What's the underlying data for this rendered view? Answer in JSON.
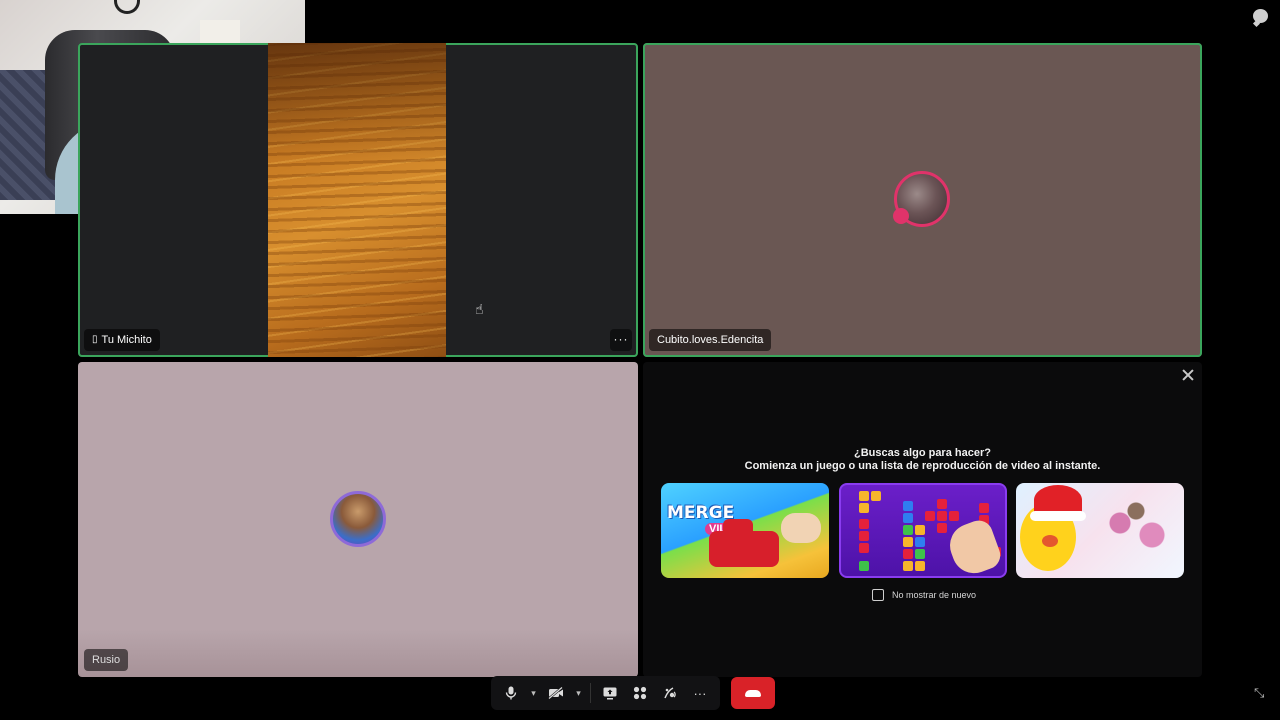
{
  "participants": [
    {
      "name": "Tu Michito",
      "device": "phone-icon"
    },
    {
      "name": "Cubito.loves.Edencita"
    },
    {
      "name": "Rusio"
    }
  ],
  "activity_panel": {
    "title": "¿Buscas algo para hacer?",
    "subtitle": "Comienza un juego o una lista de reproducción de video al instante.",
    "games": [
      {
        "name": "Merge Villes",
        "logo_text": "MERGE",
        "logo_sub": "VILLES"
      },
      {
        "name": "Block puzzle"
      },
      {
        "name": "Chick holiday"
      }
    ],
    "dont_show_label": "No mostrar de nuevo",
    "dont_show_checked": false
  },
  "toolbar": {
    "buttons": [
      "microphone-icon",
      "camera-off-icon",
      "screen-share-icon",
      "activities-icon",
      "soundboard-icon",
      "more-icon",
      "end-call-icon"
    ],
    "more_label": "···",
    "end_call_color": "#d92228"
  },
  "colors": {
    "speaking_outline": "#3ba55c",
    "cubito_tile_bg": "#6a5753",
    "rusio_tile_bg": "#b8a5ab"
  }
}
